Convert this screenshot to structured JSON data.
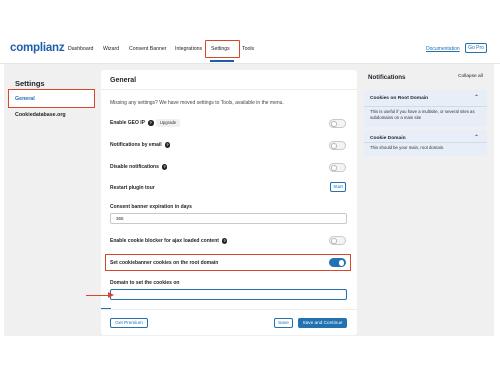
{
  "brand": {
    "logo": "complianz"
  },
  "nav": {
    "items": [
      "Dashboard",
      "Wizard",
      "Consent Banner",
      "Integrations",
      "Settings",
      "Tools"
    ],
    "documentation": "Documentation",
    "go_pro": "Go Pro"
  },
  "sidebar": {
    "title": "Settings",
    "items": [
      "General",
      "Cookiedatabase.org"
    ]
  },
  "main": {
    "title": "General",
    "notice": "Missing any settings? We have moved settings to Tools, available in the menu.",
    "rows": {
      "geo_ip": {
        "label": "Enable GEO IP",
        "badge": "Upgrade",
        "enabled": false
      },
      "email": {
        "label": "Notifications by email",
        "enabled": false
      },
      "disable_notifications": {
        "label": "Disable notifications",
        "enabled": false
      },
      "restart_tour": {
        "label": "Restart plugin tour",
        "button": "Start"
      },
      "expiration": {
        "label": "Consent banner expiration in days",
        "value": "365"
      },
      "blocker": {
        "label": "Enable cookie blocker for ajax loaded content",
        "enabled": false
      },
      "root_domain": {
        "label": "Set cookiebanner cookies on the root domain",
        "enabled": true
      },
      "domain": {
        "label": "Domain to set the cookies on",
        "value": ""
      }
    },
    "footer": {
      "get_premium": "Get Premium",
      "save": "Save",
      "save_continue": "Save and Continue"
    }
  },
  "notifications": {
    "title": "Notifications",
    "collapse_all": "Collapse all",
    "items": [
      {
        "title": "Cookies on Root Domain",
        "body": "This is useful if you have a multisite, or several sites as subdomains on a main site"
      },
      {
        "title": "Cookie Domain",
        "body": "This should be your main, root domain."
      }
    ]
  },
  "colors": {
    "accent": "#2271b1",
    "annotation": "#d9472b",
    "background": "#f0f0f1"
  }
}
